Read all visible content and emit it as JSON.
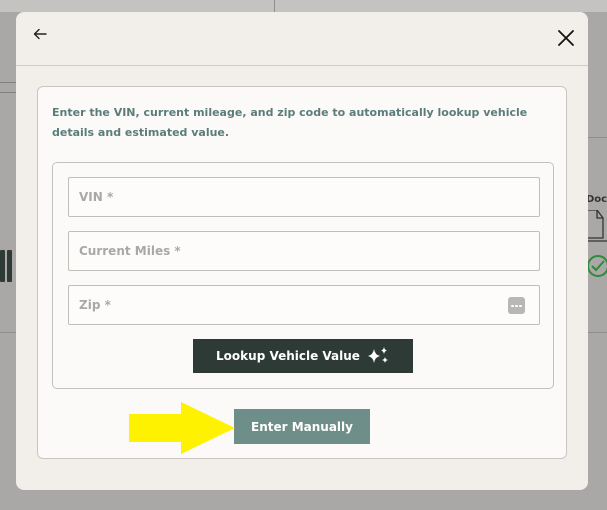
{
  "modal": {
    "back_icon": "arrow-left-icon",
    "close_icon": "close-x-icon"
  },
  "card": {
    "intro_text": "Enter the VIN, current mileage, and zip code to automatically lookup vehicle details and estimated value."
  },
  "form": {
    "vin_placeholder": "VIN *",
    "vin_value": "",
    "miles_placeholder": "Current Miles *",
    "miles_value": "",
    "zip_placeholder": "Zip *",
    "zip_value": "",
    "zip_icon": "autofill-dots-icon"
  },
  "buttons": {
    "lookup_label": "Lookup Vehicle Value",
    "lookup_icon": "sparkle-icon",
    "manual_label": "Enter Manually"
  },
  "annotation": {
    "arrow_color": "#fff200",
    "arrow_icon": "arrow-right-icon"
  },
  "background": {
    "doc_label": "Doc",
    "doc_icon": "document-check-icon"
  },
  "colors": {
    "accent_dark": "#2e3a36",
    "accent_teal": "#6e8e89",
    "intro_text": "#5a7d79"
  }
}
